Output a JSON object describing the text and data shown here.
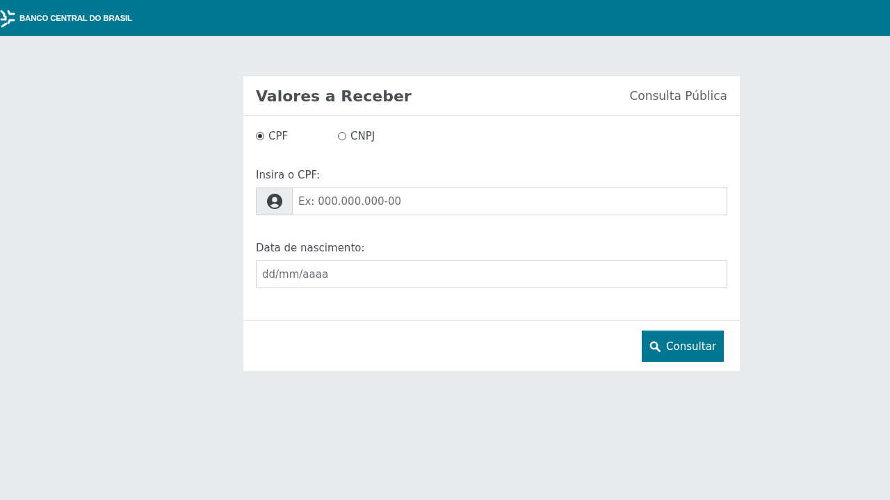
{
  "header": {
    "brand": "BANCO CENTRAL DO BRASIL"
  },
  "card": {
    "title": "Valores a Receber",
    "subtitle": "Consulta Pública",
    "id_type": {
      "options": [
        {
          "label": "CPF",
          "selected": true
        },
        {
          "label": "CNPJ",
          "selected": false
        }
      ]
    },
    "fields": [
      {
        "kind": "icon",
        "label": "Insira o CPF:",
        "placeholder": "Ex: 000.000.000-00"
      },
      {
        "kind": "plain",
        "label": "Data de nascimento:",
        "placeholder": "dd/mm/aaaa"
      }
    ],
    "button": "Consultar"
  }
}
